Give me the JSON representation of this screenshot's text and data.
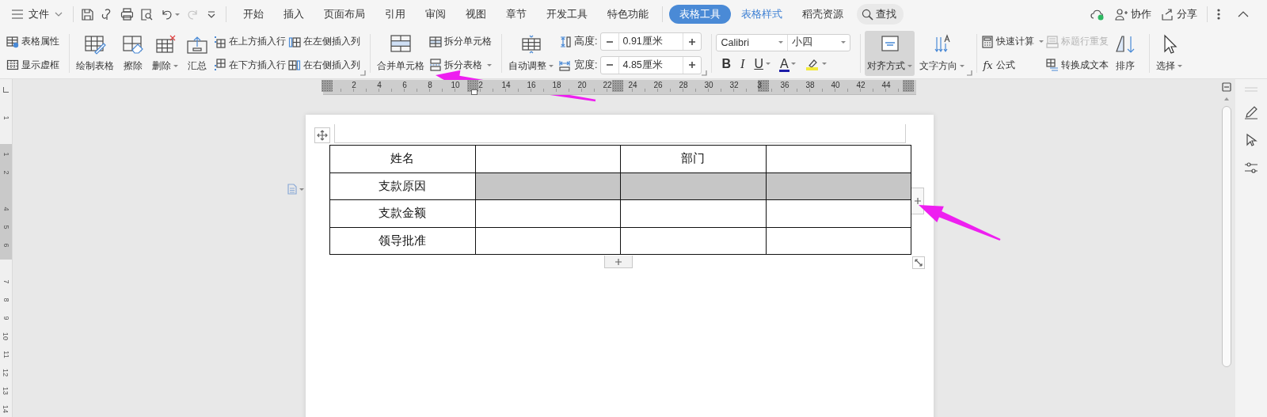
{
  "menu_button": {
    "label": "文件"
  },
  "tabs": [
    {
      "label": "开始",
      "selected": false,
      "kind": "main"
    },
    {
      "label": "插入",
      "selected": false,
      "kind": "main"
    },
    {
      "label": "页面布局",
      "selected": false,
      "kind": "main"
    },
    {
      "label": "引用",
      "selected": false,
      "kind": "main"
    },
    {
      "label": "审阅",
      "selected": false,
      "kind": "main"
    },
    {
      "label": "视图",
      "selected": false,
      "kind": "main"
    },
    {
      "label": "章节",
      "selected": false,
      "kind": "main"
    },
    {
      "label": "开发工具",
      "selected": false,
      "kind": "main"
    },
    {
      "label": "特色功能",
      "selected": false,
      "kind": "main"
    },
    {
      "label": "表格工具",
      "selected": true,
      "kind": "contextual"
    },
    {
      "label": "表格样式",
      "selected": false,
      "kind": "contextual"
    },
    {
      "label": "稻壳资源",
      "selected": false,
      "kind": "main"
    }
  ],
  "search": {
    "label": "查找"
  },
  "account_actions": [
    {
      "label": "协作"
    },
    {
      "label": "分享"
    }
  ],
  "ribbon": {
    "groups": [
      {
        "items": [
          {
            "kind": "small_stack",
            "items": [
              {
                "label": "表格属性",
                "disabled": false
              },
              {
                "label": "显示虚框",
                "disabled": false
              }
            ]
          }
        ]
      },
      {
        "launcher": true,
        "items": [
          {
            "kind": "large",
            "label": "绘制表格",
            "pressed": false
          },
          {
            "kind": "large",
            "label": "擦除",
            "pressed": false
          },
          {
            "kind": "large",
            "label": "删除",
            "dropdown": true,
            "pressed": false
          },
          {
            "kind": "large",
            "label": "汇总",
            "pressed": false
          },
          {
            "kind": "small_stack",
            "items": [
              {
                "label": "在上方插入行",
                "disabled": false
              },
              {
                "label": "在下方插入行",
                "disabled": false
              }
            ]
          },
          {
            "kind": "small_stack",
            "items": [
              {
                "label": "在左侧插入列",
                "disabled": false
              },
              {
                "label": "在右侧插入列",
                "disabled": false
              }
            ]
          }
        ]
      },
      {
        "items": [
          {
            "kind": "large",
            "label": "合并单元格",
            "pressed": false
          },
          {
            "kind": "small_stack",
            "items": [
              {
                "label": "拆分单元格",
                "disabled": false
              },
              {
                "label": "拆分表格",
                "dropdown": true,
                "disabled": false
              }
            ]
          }
        ]
      },
      {
        "launcher": true,
        "items": [
          {
            "kind": "large",
            "label": "自动调整",
            "dropdown": true,
            "pressed": false
          },
          {
            "kind": "spinner_stack",
            "items": [
              {
                "label": "高度:",
                "value": "0.91厘米"
              },
              {
                "label": "宽度:",
                "value": "4.85厘米"
              }
            ]
          }
        ]
      },
      {
        "items": [
          {
            "kind": "font",
            "font": "Calibri",
            "size": "小四",
            "formats": [
              {
                "kind": "bold",
                "label": "B"
              },
              {
                "kind": "italic",
                "label": "I"
              },
              {
                "kind": "underline",
                "label": "U",
                "dropdown": true
              },
              {
                "kind": "color",
                "label": "A",
                "dropdown": true
              },
              {
                "kind": "highlight",
                "dropdown": true
              }
            ]
          }
        ]
      },
      {
        "launcher": true,
        "items": [
          {
            "kind": "large",
            "label": "对齐方式",
            "dropdown": true,
            "pressed": true
          },
          {
            "kind": "large",
            "label": "文字方向",
            "dropdown": true,
            "pressed": false
          }
        ]
      },
      {
        "items": [
          {
            "kind": "small_stack",
            "items": [
              {
                "label": "快速计算",
                "dropdown": true,
                "disabled": false
              },
              {
                "label": "公式",
                "glyph": "fx",
                "disabled": false
              }
            ]
          },
          {
            "kind": "small_stack",
            "items": [
              {
                "label": "标题行重复",
                "disabled": true
              },
              {
                "label": "转换成文本",
                "disabled": false
              }
            ]
          },
          {
            "kind": "large",
            "label": "排序",
            "pressed": false
          }
        ]
      },
      {
        "items": [
          {
            "kind": "large",
            "label": "选择",
            "dropdown": true,
            "pressed": false
          }
        ]
      }
    ]
  },
  "horizontal_ruler": {
    "labels": [
      "2",
      "4",
      "6",
      "8",
      "10",
      "2",
      "14",
      "16",
      "18",
      "20",
      "22",
      "24",
      "26",
      "28",
      "30",
      "32",
      "3",
      "36",
      "38",
      "40",
      "42",
      "44"
    ]
  },
  "vertical_ruler": {
    "items": [
      {
        "kind": "number",
        "label": "1"
      },
      {
        "kind": "gap"
      },
      {
        "kind": "number",
        "label": "1"
      },
      {
        "kind": "number",
        "label": "2"
      },
      {
        "kind": "gap"
      },
      {
        "kind": "number",
        "label": "4"
      },
      {
        "kind": "number",
        "label": "5"
      },
      {
        "kind": "number",
        "label": "6"
      },
      {
        "kind": "gap"
      },
      {
        "kind": "number",
        "label": "7"
      },
      {
        "kind": "number",
        "label": "8"
      },
      {
        "kind": "number",
        "label": "9"
      },
      {
        "kind": "number",
        "label": "10"
      },
      {
        "kind": "number",
        "label": "11"
      },
      {
        "kind": "number",
        "label": "12"
      },
      {
        "kind": "number",
        "label": "13"
      },
      {
        "kind": "number",
        "label": "14"
      }
    ]
  },
  "table": {
    "rows": [
      [
        {
          "text": "姓名",
          "selected": false
        },
        {
          "selected": false
        },
        {
          "text": "部门",
          "selected": false
        },
        {
          "selected": false
        }
      ],
      [
        {
          "text": "支款原因",
          "selected": false
        },
        {
          "selected": true
        },
        {
          "selected": true
        },
        {
          "selected": true
        }
      ],
      [
        {
          "text": "支款金额",
          "selected": false
        },
        {
          "selected": false
        },
        {
          "selected": false
        },
        {
          "selected": false
        }
      ],
      [
        {
          "text": "领导批准",
          "selected": false
        },
        {
          "selected": false
        },
        {
          "selected": false
        },
        {
          "selected": false
        }
      ]
    ]
  }
}
